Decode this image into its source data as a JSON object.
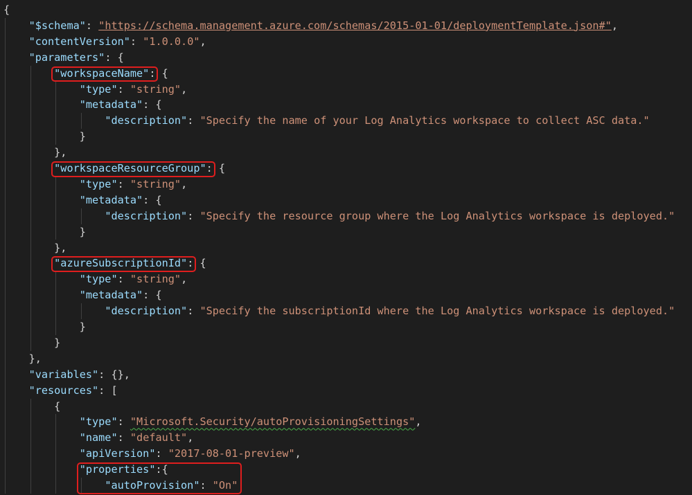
{
  "document": {
    "lines": [
      {
        "indent": 0,
        "tokens": [
          {
            "t": "punc",
            "v": "{"
          }
        ]
      },
      {
        "indent": 1,
        "tokens": [
          {
            "t": "key",
            "v": "\"$schema\""
          },
          {
            "t": "punc",
            "v": ": "
          },
          {
            "t": "link",
            "v": "\"https://schema.management.azure.com/schemas/2015-01-01/deploymentTemplate.json#\""
          },
          {
            "t": "punc",
            "v": ","
          }
        ]
      },
      {
        "indent": 1,
        "tokens": [
          {
            "t": "key",
            "v": "\"contentVersion\""
          },
          {
            "t": "punc",
            "v": ": "
          },
          {
            "t": "str",
            "v": "\"1.0.0.0\""
          },
          {
            "t": "punc",
            "v": ","
          }
        ]
      },
      {
        "indent": 1,
        "tokens": [
          {
            "t": "key",
            "v": "\"parameters\""
          },
          {
            "t": "punc",
            "v": ": {"
          }
        ]
      },
      {
        "indent": 2,
        "tokens": [
          {
            "t": "key",
            "v": "\"workspaceName\""
          },
          {
            "t": "punc",
            "v": ": {"
          }
        ]
      },
      {
        "indent": 3,
        "tokens": [
          {
            "t": "key",
            "v": "\"type\""
          },
          {
            "t": "punc",
            "v": ": "
          },
          {
            "t": "str",
            "v": "\"string\""
          },
          {
            "t": "punc",
            "v": ","
          }
        ]
      },
      {
        "indent": 3,
        "tokens": [
          {
            "t": "key",
            "v": "\"metadata\""
          },
          {
            "t": "punc",
            "v": ": {"
          }
        ]
      },
      {
        "indent": 4,
        "tokens": [
          {
            "t": "key",
            "v": "\"description\""
          },
          {
            "t": "punc",
            "v": ": "
          },
          {
            "t": "str",
            "v": "\"Specify the name of your Log Analytics workspace to collect ASC data.\""
          }
        ]
      },
      {
        "indent": 3,
        "tokens": [
          {
            "t": "punc",
            "v": "}"
          }
        ]
      },
      {
        "indent": 2,
        "tokens": [
          {
            "t": "punc",
            "v": "},"
          }
        ]
      },
      {
        "indent": 2,
        "tokens": [
          {
            "t": "key",
            "v": "\"workspaceResourceGroup\""
          },
          {
            "t": "punc",
            "v": ": {"
          }
        ]
      },
      {
        "indent": 3,
        "tokens": [
          {
            "t": "key",
            "v": "\"type\""
          },
          {
            "t": "punc",
            "v": ": "
          },
          {
            "t": "str",
            "v": "\"string\""
          },
          {
            "t": "punc",
            "v": ","
          }
        ]
      },
      {
        "indent": 3,
        "tokens": [
          {
            "t": "key",
            "v": "\"metadata\""
          },
          {
            "t": "punc",
            "v": ": {"
          }
        ]
      },
      {
        "indent": 4,
        "tokens": [
          {
            "t": "key",
            "v": "\"description\""
          },
          {
            "t": "punc",
            "v": ": "
          },
          {
            "t": "str",
            "v": "\"Specify the resource group where the Log Analytics workspace is deployed.\""
          }
        ]
      },
      {
        "indent": 3,
        "tokens": [
          {
            "t": "punc",
            "v": "}"
          }
        ]
      },
      {
        "indent": 2,
        "tokens": [
          {
            "t": "punc",
            "v": "},"
          }
        ]
      },
      {
        "indent": 2,
        "tokens": [
          {
            "t": "key",
            "v": "\"azureSubscriptionId\""
          },
          {
            "t": "punc",
            "v": ": {"
          }
        ]
      },
      {
        "indent": 3,
        "tokens": [
          {
            "t": "key",
            "v": "\"type\""
          },
          {
            "t": "punc",
            "v": ": "
          },
          {
            "t": "str",
            "v": "\"string\""
          },
          {
            "t": "punc",
            "v": ","
          }
        ]
      },
      {
        "indent": 3,
        "tokens": [
          {
            "t": "key",
            "v": "\"metadata\""
          },
          {
            "t": "punc",
            "v": ": {"
          }
        ]
      },
      {
        "indent": 4,
        "tokens": [
          {
            "t": "key",
            "v": "\"description\""
          },
          {
            "t": "punc",
            "v": ": "
          },
          {
            "t": "str",
            "v": "\"Specify the subscriptionId where the Log Analytics workspace is deployed.\""
          }
        ]
      },
      {
        "indent": 3,
        "tokens": [
          {
            "t": "punc",
            "v": "}"
          }
        ]
      },
      {
        "indent": 2,
        "tokens": [
          {
            "t": "punc",
            "v": "}"
          }
        ]
      },
      {
        "indent": 1,
        "tokens": [
          {
            "t": "punc",
            "v": "},"
          }
        ]
      },
      {
        "indent": 1,
        "tokens": [
          {
            "t": "key",
            "v": "\"variables\""
          },
          {
            "t": "punc",
            "v": ": {},"
          }
        ]
      },
      {
        "indent": 1,
        "tokens": [
          {
            "t": "key",
            "v": "\"resources\""
          },
          {
            "t": "punc",
            "v": ": ["
          }
        ]
      },
      {
        "indent": 2,
        "tokens": [
          {
            "t": "punc",
            "v": "{"
          }
        ]
      },
      {
        "indent": 3,
        "tokens": [
          {
            "t": "key",
            "v": "\"type\""
          },
          {
            "t": "punc",
            "v": ": "
          },
          {
            "t": "str",
            "v": "\"Microsoft.Security/autoProvisioningSettings\"",
            "squiggle": true
          },
          {
            "t": "punc",
            "v": ","
          }
        ]
      },
      {
        "indent": 3,
        "tokens": [
          {
            "t": "key",
            "v": "\"name\""
          },
          {
            "t": "punc",
            "v": ": "
          },
          {
            "t": "str",
            "v": "\"default\""
          },
          {
            "t": "punc",
            "v": ","
          }
        ]
      },
      {
        "indent": 3,
        "tokens": [
          {
            "t": "key",
            "v": "\"apiVersion\""
          },
          {
            "t": "punc",
            "v": ": "
          },
          {
            "t": "str",
            "v": "\"2017-08-01-preview\""
          },
          {
            "t": "punc",
            "v": ","
          }
        ]
      },
      {
        "indent": 3,
        "tokens": [
          {
            "t": "key",
            "v": "\"properties\""
          },
          {
            "t": "punc",
            "v": ":{"
          }
        ]
      },
      {
        "indent": 4,
        "tokens": [
          {
            "t": "key",
            "v": "\"autoProvision\""
          },
          {
            "t": "punc",
            "v": ": "
          },
          {
            "t": "str",
            "v": "\"On\""
          }
        ]
      }
    ],
    "highlights": [
      {
        "name": "highlight-workspace-name",
        "line": 4
      },
      {
        "name": "highlight-workspace-resource-group",
        "line": 10
      },
      {
        "name": "highlight-azure-subscription-id",
        "line": 16
      },
      {
        "name": "highlight-properties-block",
        "line": 29,
        "endLine": 30
      }
    ],
    "colors": {
      "background": "#1e1e1e",
      "key": "#9cdcfe",
      "string": "#ce9178",
      "punctuation": "#d4d4d4",
      "highlight_border": "#e01e1e",
      "squiggle": "#4bb34b"
    }
  }
}
